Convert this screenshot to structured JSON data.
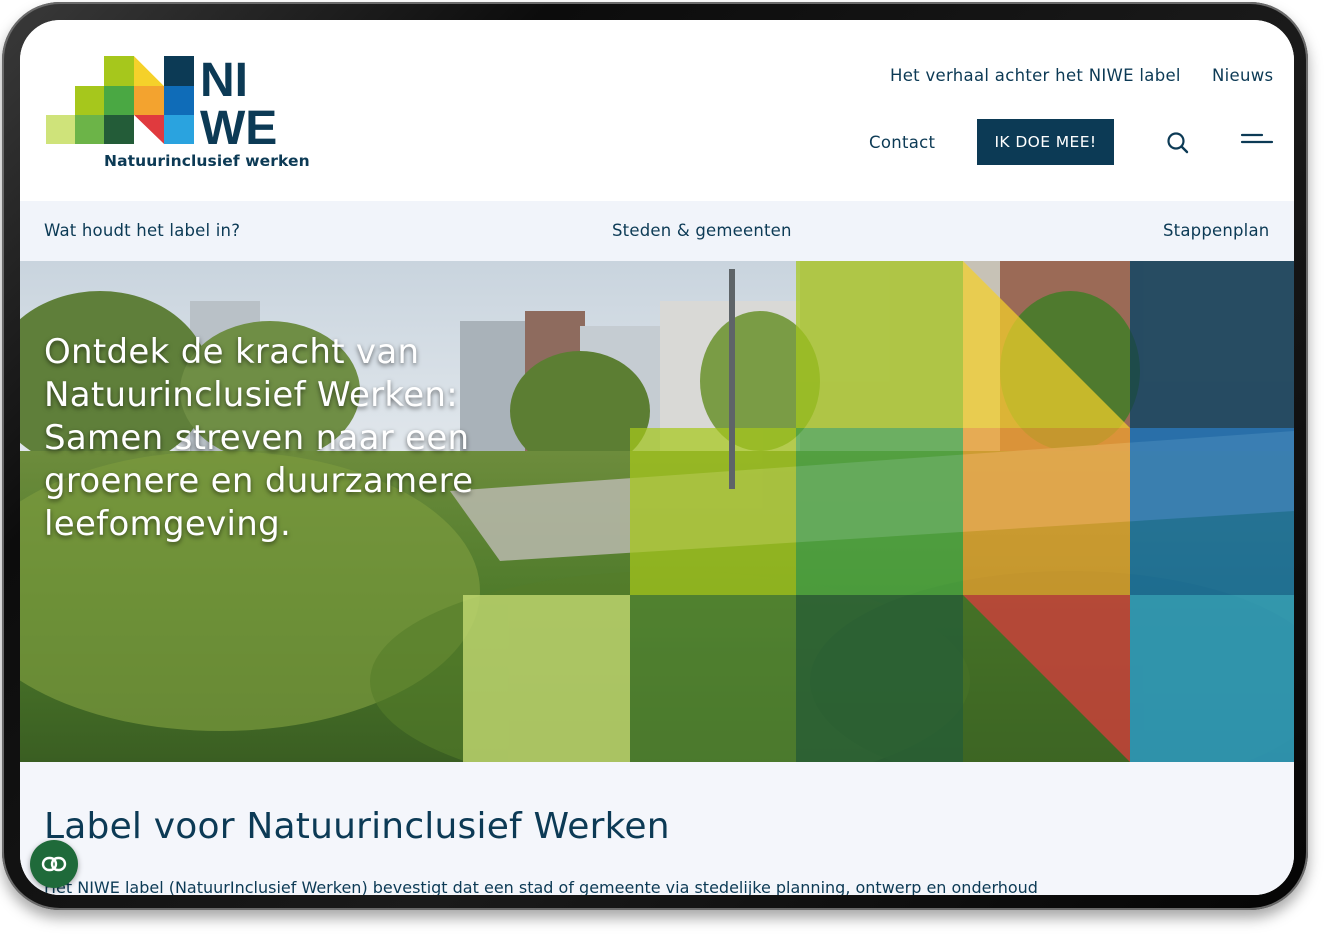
{
  "brand": {
    "logo_line1": "NI",
    "logo_line2": "WE",
    "tagline": "Natuurinclusief werken",
    "colors": {
      "navy": "#0c3a55",
      "lime": "#a6c71c",
      "yellow": "#f5d12a",
      "green": "#4aa843",
      "dark_green": "#235c38",
      "orange": "#f3a32f",
      "red": "#e03a3e",
      "blue": "#0f6cb8",
      "light_blue": "#2aa3df",
      "pale_lime": "#cfe37a"
    }
  },
  "header": {
    "links": {
      "story": "Het verhaal achter het NIWE label",
      "news": "Nieuws",
      "contact": "Contact"
    },
    "cta_label": "IK DOE MEE!",
    "search_icon": "search-icon",
    "menu_icon": "menu-icon"
  },
  "subnav": {
    "items": [
      "Wat houdt het label in?",
      "Steden & gemeenten",
      "Stappenplan"
    ]
  },
  "hero": {
    "title": "Ontdek de kracht van Natuurinclusief Werken: Samen streven naar een groenere en duurzamere leefomgeving."
  },
  "content": {
    "heading": "Label voor Natuurinclusief Werken",
    "intro": "Het NIWE label (NatuurInclusief Werken) bevestigt dat een stad of gemeente via stedelijke planning, ontwerp en onderhoud"
  },
  "chat_widget": {
    "icon": "chat-icon"
  }
}
